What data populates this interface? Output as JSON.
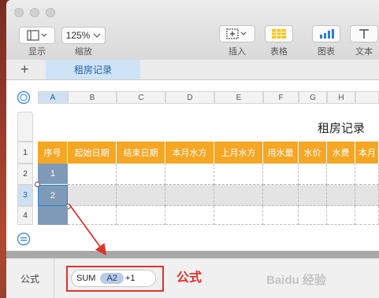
{
  "toolbar": {
    "view_label": "显示",
    "zoom_value": "125%",
    "zoom_label": "缩放",
    "insert_label": "插入",
    "table_label": "表格",
    "chart_label": "图表",
    "text_label": "文本"
  },
  "sheet_tab": {
    "add": "+",
    "name": "租房记录"
  },
  "columns": [
    "A",
    "B",
    "C",
    "D",
    "E",
    "F",
    "G",
    "H"
  ],
  "rows": [
    "1",
    "2",
    "3",
    "4"
  ],
  "table": {
    "title": "租房记录",
    "headers": [
      "序号",
      "起始日期",
      "结束日期",
      "本月水方",
      "上月水方",
      "用水量",
      "水价",
      "水费",
      "本月"
    ],
    "row2_seq": "1",
    "row3_seq": "2"
  },
  "formula_bar": {
    "label": "公式",
    "func": "SUM",
    "ref": "A2",
    "suffix": "+1"
  },
  "annotation": {
    "text": "公式",
    "color": "#e0322b"
  },
  "watermark": "Baidu 经验",
  "colors": {
    "header_orange": "#f5a623",
    "selected_blue": "#7f9ab7",
    "tab_blue": "#cfe3f7"
  }
}
